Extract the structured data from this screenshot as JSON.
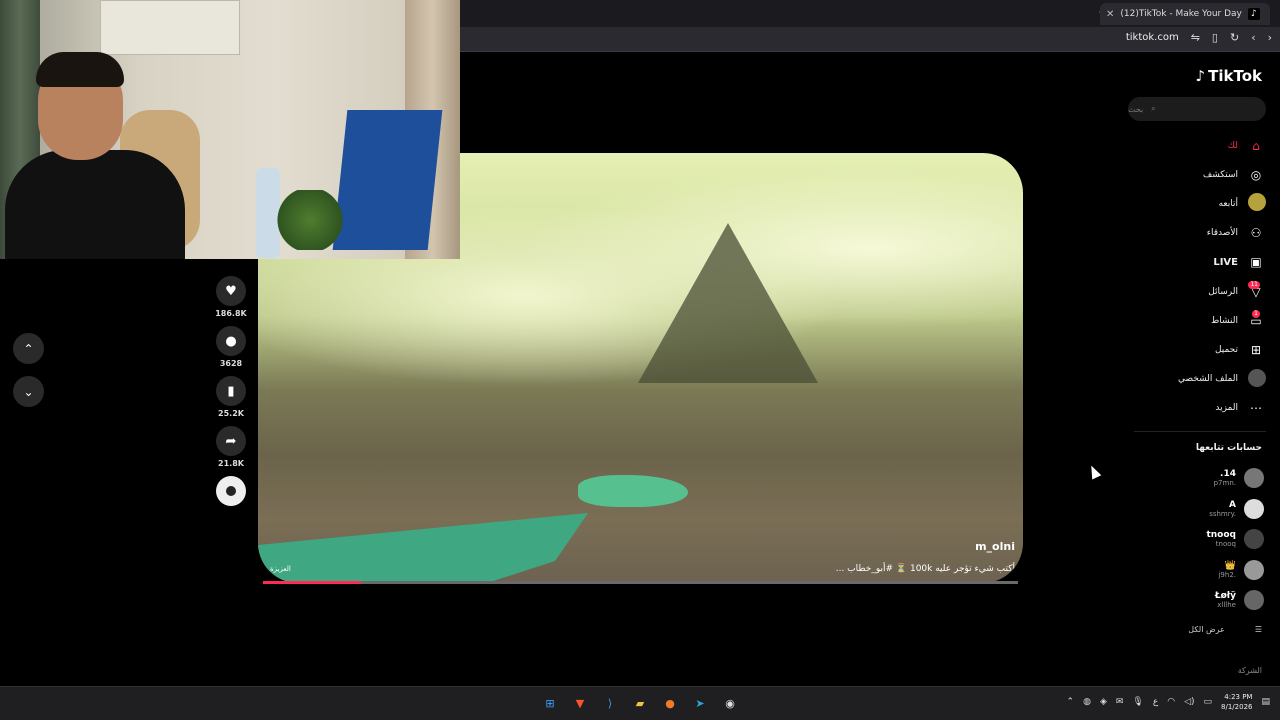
{
  "browser": {
    "tab_title": "(12)TikTok - Make Your Day",
    "tab_close": "✕",
    "new_tab": "+",
    "url": "tiktok.com"
  },
  "logo": {
    "text": "TikTok"
  },
  "search": {
    "placeholder": "بحث"
  },
  "menu": [
    {
      "label": "لك",
      "icon": "home-icon",
      "active": true
    },
    {
      "label": "استكشف",
      "icon": "compass-icon"
    },
    {
      "label": "أتابعه",
      "icon": "following-avatar-icon"
    },
    {
      "label": "الأصدقاء",
      "icon": "friends-icon"
    },
    {
      "label": "LIVE",
      "icon": "live-icon"
    },
    {
      "label": "الرسائل",
      "icon": "messages-icon",
      "badge": "11"
    },
    {
      "label": "النشاط",
      "icon": "activity-icon",
      "badge": "1"
    },
    {
      "label": "تحميل",
      "icon": "upload-icon"
    },
    {
      "label": "الملف الشخصي",
      "icon": "profile-avatar-icon"
    },
    {
      "label": "المزيد",
      "icon": "more-icon"
    }
  ],
  "following_header": "حسابات تتابعها",
  "following": [
    {
      "name": ".14",
      "handle": "p7mn."
    },
    {
      "name": "A",
      "handle": "sshmry."
    },
    {
      "name": "tnooq",
      "handle": "tnooq"
    },
    {
      "name": "👑",
      "handle": "j9h2."
    },
    {
      "name": "Łøłÿ",
      "handle": "xlllhe"
    }
  ],
  "see_all": "عرض الكل",
  "company": "الشركة",
  "video": {
    "username": "m_olni",
    "caption": "أكتب شيء تؤجر عليه 100k ⏳ #أبو_خطاب ...",
    "music": "العزيزة",
    "progress": 0.13
  },
  "actions": {
    "likes": "186.8K",
    "comments": "3628",
    "saves": "25.2K",
    "shares": "21.8K"
  },
  "taskbar": {
    "time": "4:23 PM",
    "date": "8/1/2026",
    "lang": "ع"
  }
}
